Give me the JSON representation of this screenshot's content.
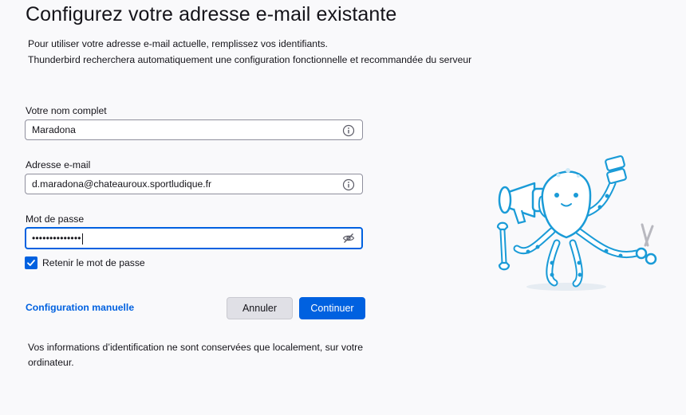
{
  "header": {
    "title": "Configurez votre adresse e-mail existante",
    "intro_line1": "Pour utiliser votre adresse e-mail actuelle, remplissez vos identifiants.",
    "intro_line2": "Thunderbird recherchera automatiquement une configuration fonctionnelle et recommandée du serveur"
  },
  "form": {
    "name": {
      "label": "Votre nom complet",
      "value": "Maradona",
      "icon": "info-icon"
    },
    "email": {
      "label": "Adresse e-mail",
      "value": "d.maradona@chateauroux.sportludique.fr",
      "icon": "info-icon"
    },
    "password": {
      "label": "Mot de passe",
      "masked_value": "••••••••••••••",
      "icon": "eye-slash-icon"
    },
    "remember": {
      "label": "Retenir le mot de passe",
      "checked": true
    }
  },
  "actions": {
    "manual_config": "Configuration manuelle",
    "cancel": "Annuler",
    "continue": "Continuer"
  },
  "footer": {
    "notice": "Vos informations d’identification ne sont conservées que localement, sur votre ordinateur."
  },
  "colors": {
    "accent": "#0061e0",
    "background": "#f9f9fb",
    "illustration_blue": "#1a9bd7"
  }
}
